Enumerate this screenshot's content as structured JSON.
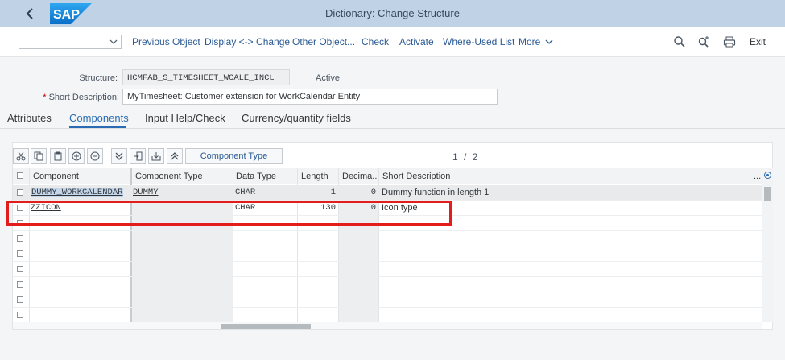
{
  "shell": {
    "title": "Dictionary: Change Structure",
    "logo_text": "SAP"
  },
  "toolbar": {
    "dropdown_value": "",
    "buttons": [
      "Previous Object",
      "Display <-> Change",
      "Other Object...",
      "Check",
      "Activate",
      "Where-Used List",
      "More"
    ],
    "exit_label": "Exit",
    "icons": [
      "search-icon",
      "search-plus-icon",
      "print-icon"
    ]
  },
  "header": {
    "structure_label": "Structure:",
    "structure_value": "HCMFAB_S_TIMESHEET_WCALE_INCL",
    "status": "Active",
    "required_mark": "*",
    "short_desc_label": "Short Description:",
    "short_desc_value": "MyTimesheet: Customer extension for WorkCalendar Entity"
  },
  "tabs": [
    "Attributes",
    "Components",
    "Input Help/Check",
    "Currency/quantity fields"
  ],
  "panel_toolbar": {
    "component_type_button": "Component Type",
    "pager": "1 / 2"
  },
  "table": {
    "columns": [
      "Component",
      "Component Type",
      "Data Type",
      "Length",
      "Decima...",
      "Short Description"
    ],
    "more_columns_label": "...",
    "rows": [
      {
        "component": "DUMMY_WORKCALENDAR",
        "component_type": "DUMMY",
        "data_type": "CHAR",
        "length": "1",
        "decimals": "0",
        "short_description": "Dummy function in length 1"
      },
      {
        "component": "ZZICON",
        "component_type": "",
        "data_type": "CHAR",
        "length": "130",
        "decimals": "0",
        "short_description": "Icon type"
      }
    ]
  },
  "colors": {
    "shell": "#bfd2e6",
    "accent": "#2a6cb4",
    "highlight": "#e31c1c"
  }
}
